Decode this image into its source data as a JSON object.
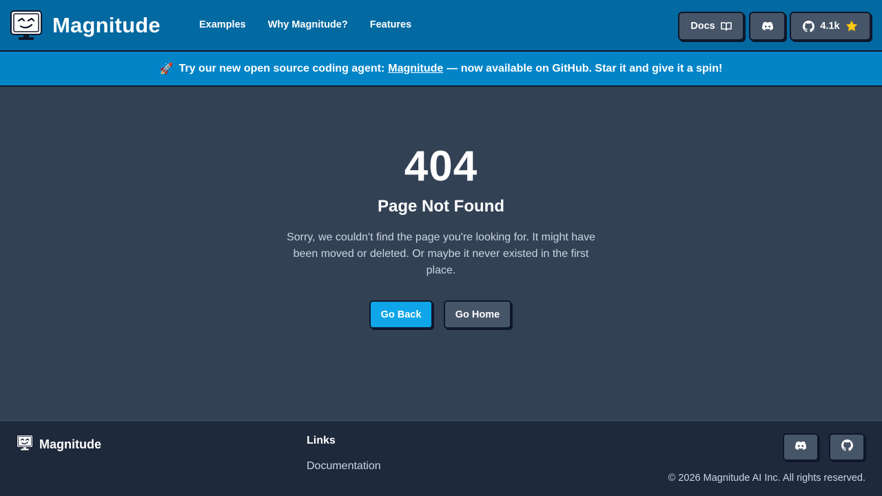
{
  "header": {
    "brand": "Magnitude",
    "nav": [
      {
        "label": "Examples"
      },
      {
        "label": "Why Magnitude?"
      },
      {
        "label": "Features"
      }
    ],
    "docs_label": "Docs",
    "github_stars": "4.1k"
  },
  "banner": {
    "emoji": "🚀",
    "prefix": "Try our new open source coding agent:",
    "link": "Magnitude",
    "suffix": "— now available on GitHub. Star it and give it a spin!"
  },
  "main": {
    "code": "404",
    "title": "Page Not Found",
    "message": "Sorry, we couldn't find the page you're looking for. It might have been moved or deleted. Or maybe it never existed in the first place.",
    "back_label": "Go Back",
    "home_label": "Go Home"
  },
  "footer": {
    "brand": "Magnitude",
    "links_heading": "Links",
    "links": [
      {
        "label": "Documentation"
      }
    ],
    "copyright": "© 2026 Magnitude AI Inc. All rights reserved."
  },
  "colors": {
    "header_bg": "#0369a1",
    "banner_bg": "#0284c7",
    "main_bg": "#334155",
    "footer_bg": "#1e293b",
    "primary_button": "#0ea5e9",
    "secondary_button": "#475569",
    "star": "#facc15"
  },
  "icons": [
    "monitor-face-logo-icon",
    "book-open-icon",
    "discord-icon",
    "github-icon",
    "star-icon",
    "rocket-icon"
  ]
}
